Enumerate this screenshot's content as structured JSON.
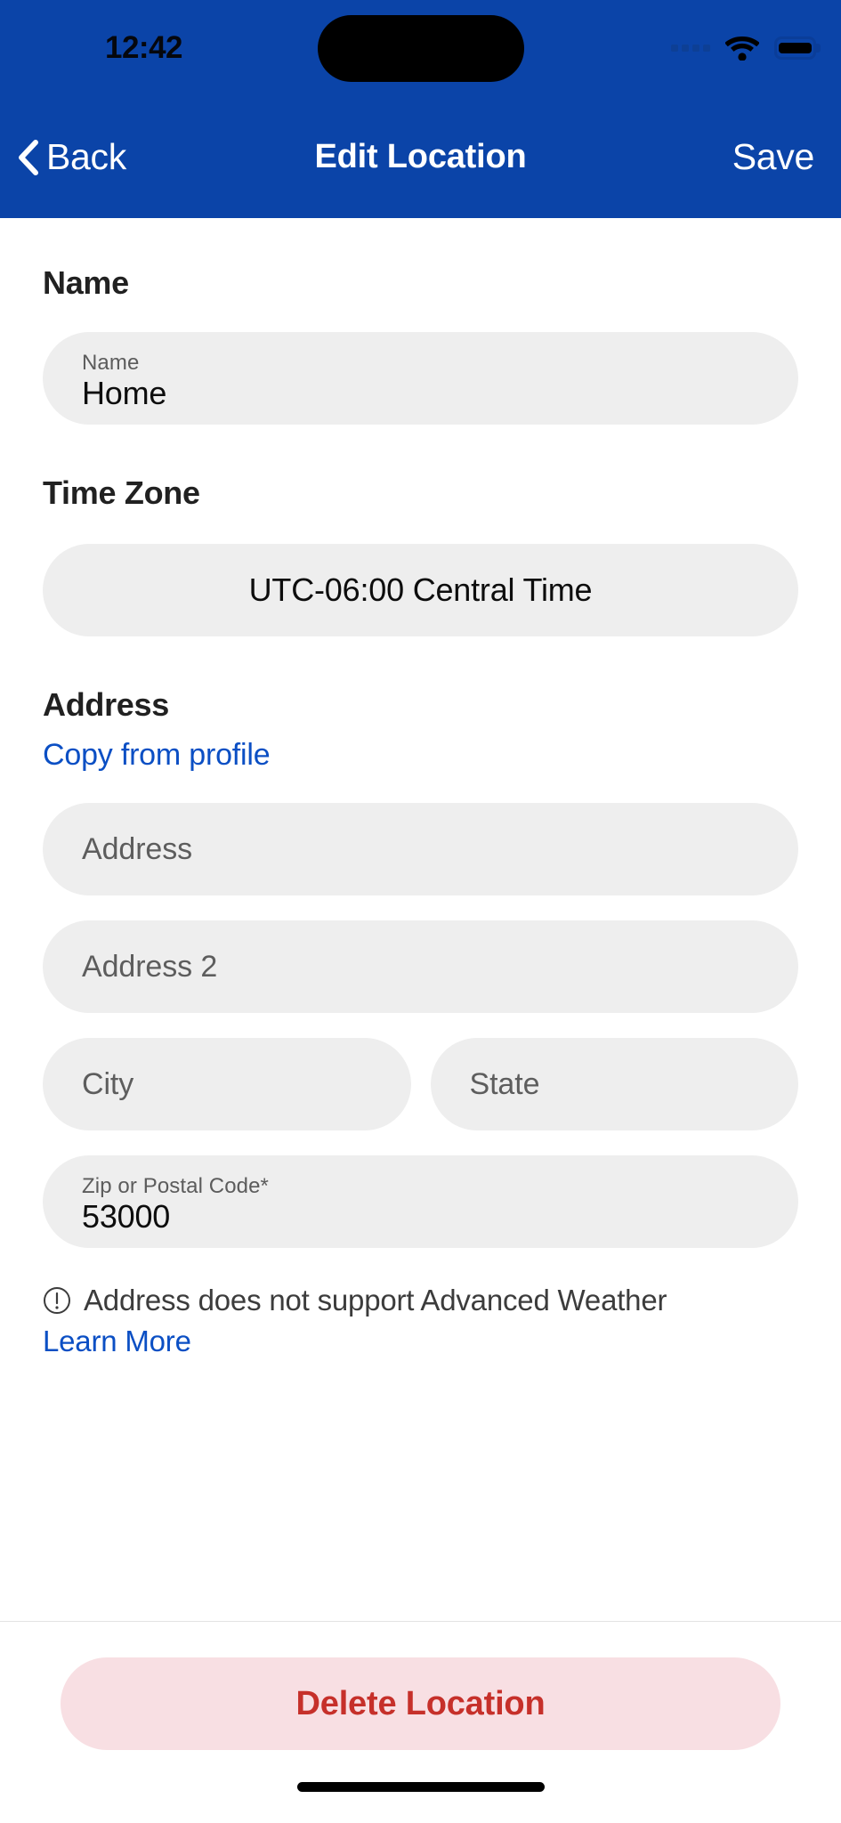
{
  "status_bar": {
    "time": "12:42",
    "icons": [
      "signal-dots-icon",
      "wifi-icon",
      "battery-icon"
    ]
  },
  "nav_bar": {
    "back_label": "Back",
    "title": "Edit Location",
    "save_label": "Save"
  },
  "sections": {
    "name": {
      "heading": "Name",
      "field": {
        "label": "Name",
        "value": "Home"
      }
    },
    "time_zone": {
      "heading": "Time Zone",
      "field": {
        "value": "UTC-06:00 Central Time"
      }
    },
    "address": {
      "heading": "Address",
      "copy_link": "Copy from profile",
      "fields": {
        "address1": {
          "placeholder": "Address",
          "value": ""
        },
        "address2": {
          "placeholder": "Address 2",
          "value": ""
        },
        "city": {
          "placeholder": "City",
          "value": ""
        },
        "state": {
          "placeholder": "State",
          "value": ""
        },
        "zip": {
          "label": "Zip or Postal Code*",
          "value": "53000"
        }
      },
      "warning": {
        "icon": "exclamation-circle-icon",
        "text": "Address does not support Advanced Weather",
        "learn_more": "Learn More"
      }
    }
  },
  "footer": {
    "delete_label": "Delete Location"
  },
  "colors": {
    "brand_blue": "#0b44a8",
    "link_blue": "#0b4fc4",
    "field_gray": "#eeeeee",
    "danger_red": "#c6302a",
    "danger_bg": "#f8dfe3"
  }
}
